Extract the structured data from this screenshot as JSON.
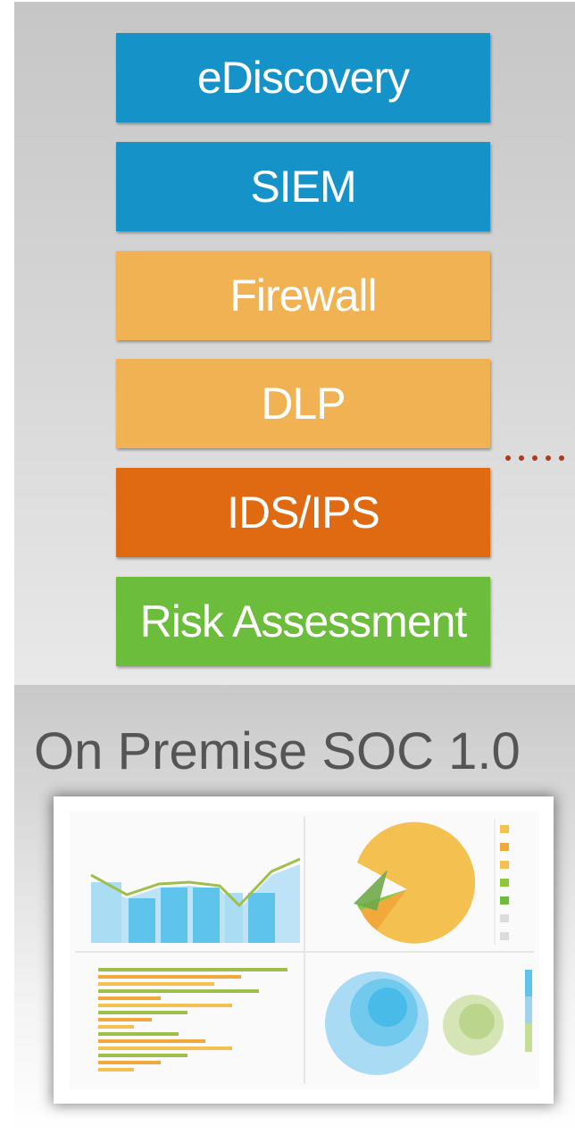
{
  "stack": {
    "items": [
      {
        "label": "eDiscovery",
        "color": "#1593c9"
      },
      {
        "label": "SIEM",
        "color": "#1593c9"
      },
      {
        "label": "Firewall",
        "color": "#f0b253"
      },
      {
        "label": "DLP",
        "color": "#f0b253"
      },
      {
        "label": "IDS/IPS",
        "color": "#e06a12"
      },
      {
        "label": "Risk Assessment",
        "color": "#6cbd3c"
      }
    ]
  },
  "connector": {
    "color": "#b03a1a",
    "style": "dotted"
  },
  "soc": {
    "title": "On Premise SOC 1.0"
  },
  "dashboard": {
    "icon": "dashboard-thumbnail-icon"
  }
}
